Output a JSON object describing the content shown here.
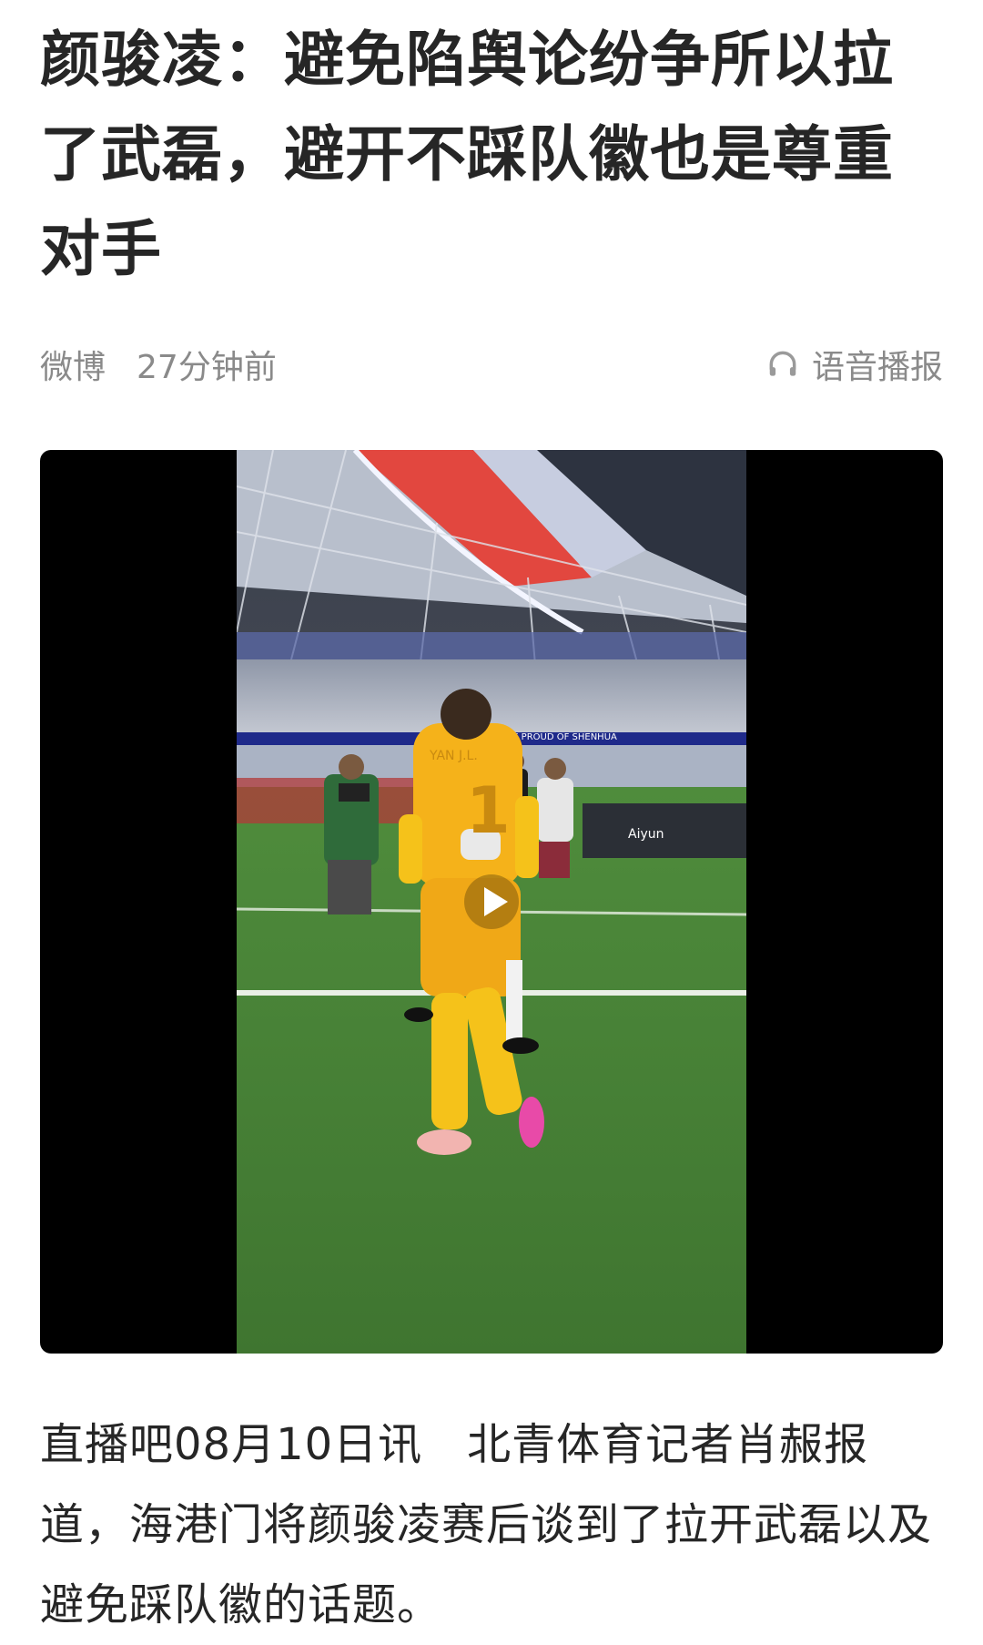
{
  "article": {
    "title": "颜骏凌：避免陷舆论纷争所以拉了武磊，避开不踩队徽也是尊重对手",
    "source": "微博",
    "time": "27分钟前",
    "audio_label": "语音播报",
    "paragraph": "直播吧08月10日讯　北青体育记者肖赧报道，海港门将颜骏凌赛后谈到了拉开武磊以及避免踩队徽的话题。"
  },
  "video": {
    "banner_text": "WE ARE PROUD OF SHENHUA",
    "jersey_text": "YAN J.L.",
    "jersey_number": "1",
    "board_text": "Aiyun"
  },
  "icons": {
    "audio": "headphones-icon",
    "play": "play-icon"
  },
  "colors": {
    "text": "#262626",
    "meta": "#8a8a8a",
    "player_bg": "#000000",
    "jersey": "#f5b21a"
  }
}
